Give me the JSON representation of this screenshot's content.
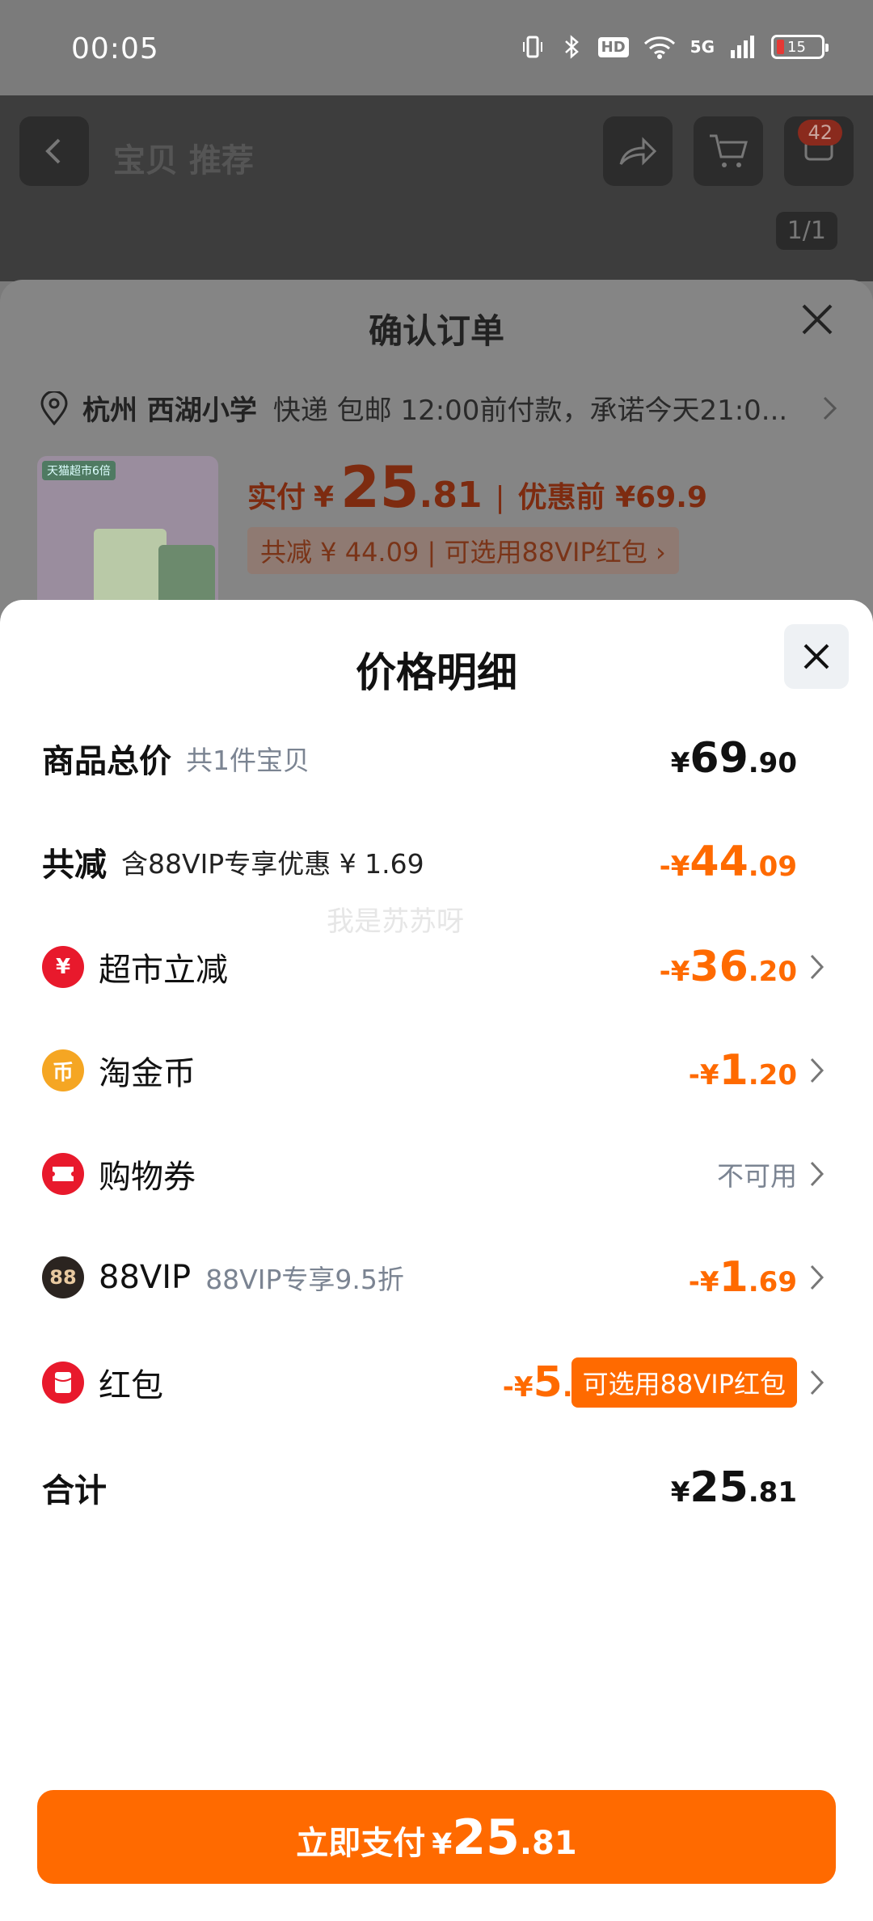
{
  "status_bar": {
    "time": "00:05",
    "network": "5G",
    "hd": "HD",
    "battery": "15"
  },
  "background_page": {
    "title": "宝贝 推荐",
    "cart_badge": "42",
    "image_counter": "1/1"
  },
  "order_sheet": {
    "title": "确认订单",
    "address_city": "杭州 西湖小学",
    "address_detail": "快递 包邮 12:00前付款，承诺今天21:0...",
    "product_tag": "天猫超市6倍",
    "paid_label": "实付",
    "paid_currency": "¥",
    "paid_int": "25",
    "paid_dec": ".81",
    "separator": "|",
    "pre_discount": "优惠前 ¥69.9",
    "discount_text": "共减 ¥ 44.09 | 可选用88VIP红包 ›"
  },
  "price_detail": {
    "title": "价格明细",
    "rows": [
      {
        "label": "商品总价",
        "sub": "共1件宝贝",
        "currency": "¥",
        "int": "69",
        "dec": ".90"
      },
      {
        "label": "共减",
        "sub": "含88VIP专享优惠 ¥ 1.69",
        "currency": "-¥",
        "int": "44",
        "dec": ".09"
      },
      {
        "label": "超市立减",
        "currency": "-¥",
        "int": "36",
        "dec": ".20"
      },
      {
        "label": "淘金币",
        "currency": "-¥",
        "int": "1",
        "dec": ".20"
      },
      {
        "label": "购物券",
        "status": "不可用"
      },
      {
        "label": "88VIP",
        "sub": "88VIP专享9.5折",
        "currency": "-¥",
        "int": "1",
        "dec": ".69"
      },
      {
        "label": "红包",
        "currency": "-¥",
        "int": "5",
        "dec": ".00",
        "button": "可选用88VIP红包"
      },
      {
        "label": "合计",
        "currency": "¥",
        "int": "25",
        "dec": ".81"
      }
    ],
    "icons": {
      "supermarket": "¥",
      "coin": "币",
      "vip": "88"
    },
    "watermark": "我是苏苏呀"
  },
  "pay_button": {
    "label": "立即支付",
    "currency": "¥",
    "int": "25",
    "dec": ".81"
  },
  "colors": {
    "accent": "#ff6a00",
    "red": "#e8192c",
    "coin": "#f5a623",
    "vip": "#2b2420"
  }
}
